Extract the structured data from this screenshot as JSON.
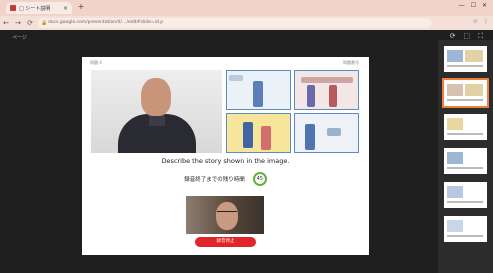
{
  "browser": {
    "tab_title": "□ シート説明",
    "tab_close": "×",
    "new_tab": "+",
    "window_controls": [
      "—",
      "☐",
      "✕"
    ],
    "url": "docs.google.com/presentation/d/…/edit#slide=id.p",
    "nav": [
      "←",
      "→",
      "⟳",
      "⌂"
    ],
    "right_icons": [
      "☆",
      "⋮"
    ]
  },
  "viewer": {
    "top_label": "ページ",
    "tools": [
      "⟳",
      "⬚",
      "⛶"
    ]
  },
  "slide": {
    "corner_left": "問題 4",
    "corner_right": "問題番号",
    "prompt": "Describe the story shown in the image.",
    "timer_label": "録音終了までの残り時間",
    "timer_value": "45",
    "record_button": "録音停止"
  },
  "colors": {
    "accent_red": "#e0242a",
    "timer_green": "#62b33b",
    "selected_thumb": "#f07e3c"
  }
}
